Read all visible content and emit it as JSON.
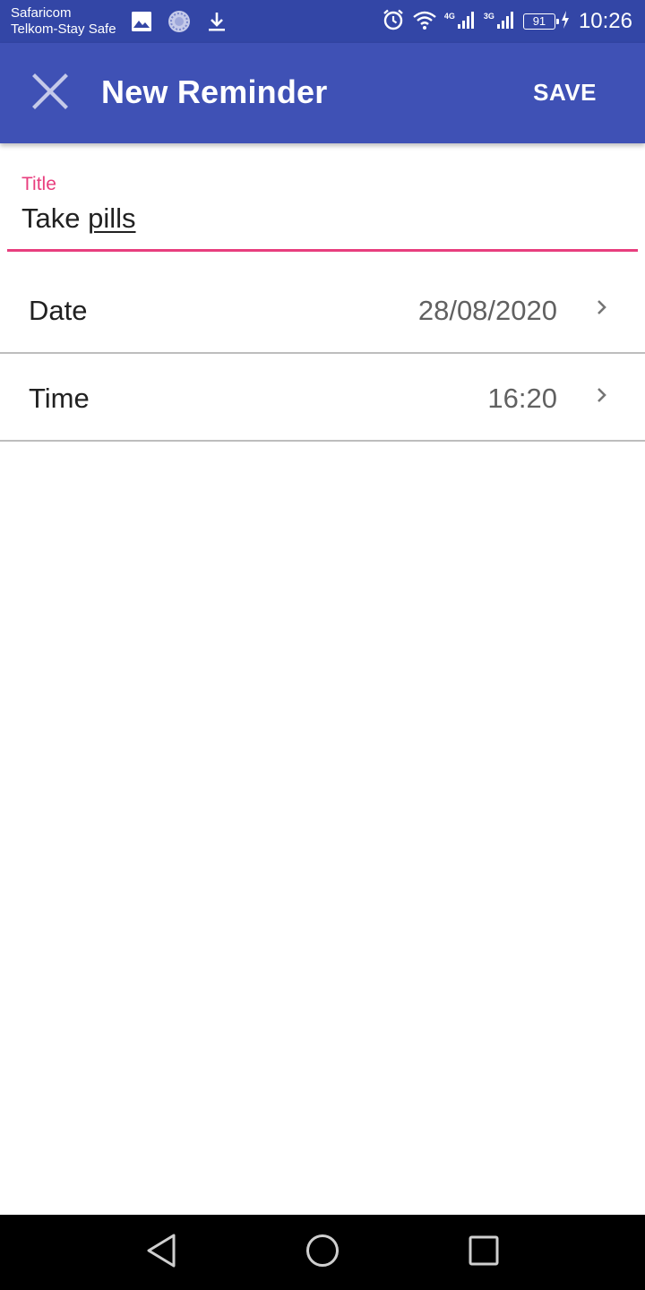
{
  "status_bar": {
    "carrier_1": "Safaricom",
    "carrier_2": "Telkom-Stay Safe",
    "icons_left": [
      "image-icon",
      "circle-app-icon",
      "download-icon"
    ],
    "icons_right": [
      "alarm-icon",
      "wifi-icon",
      "signal-4g-icon",
      "signal-3g-icon",
      "battery-icon",
      "charging-icon"
    ],
    "network_1": "4G",
    "network_2": "3G",
    "battery_level": "91",
    "time": "10:26"
  },
  "app_bar": {
    "title": "New Reminder",
    "save_label": "SAVE",
    "close_icon": "close-icon",
    "color": "#3f51b5"
  },
  "title_field": {
    "label": "Title",
    "value_prefix": "Take ",
    "value_spellcheck_word": "pills",
    "accent_color": "#e83e7e"
  },
  "date_row": {
    "label": "Date",
    "value": "28/08/2020",
    "icon": "chevron-right-icon"
  },
  "time_row": {
    "label": "Time",
    "value": "16:20",
    "icon": "chevron-right-icon"
  },
  "nav_bar": {
    "back_icon": "back-triangle-icon",
    "home_icon": "home-circle-icon",
    "recents_icon": "recents-square-icon"
  }
}
